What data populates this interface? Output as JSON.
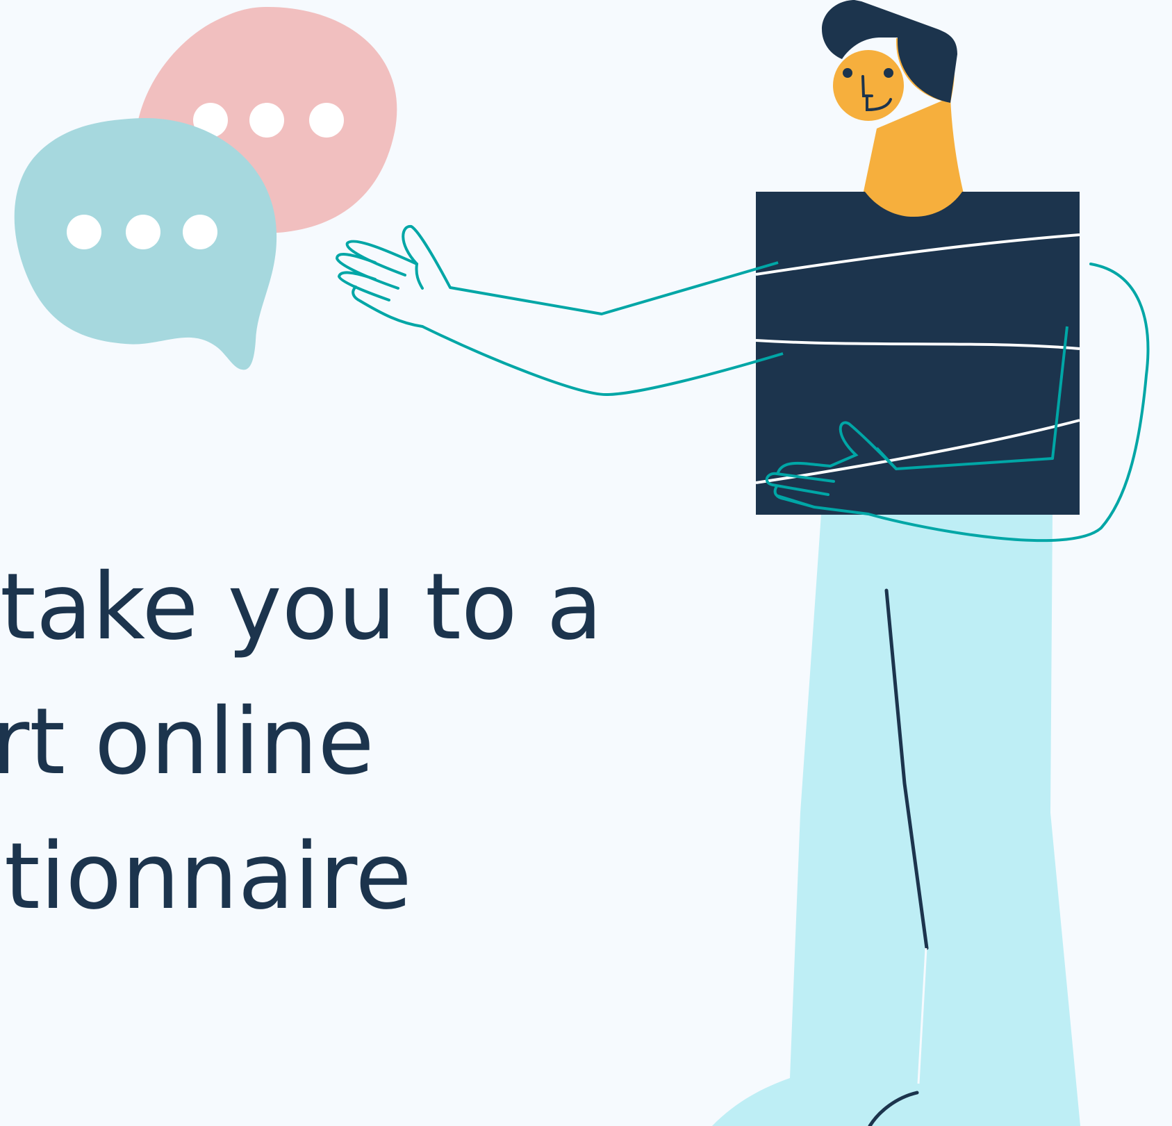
{
  "colors": {
    "background": "#F6FAFE",
    "text": "#1C344D",
    "navy": "#1C344D",
    "skin": "#F6AF3D",
    "pants": "#BEEEF5",
    "teal": "#00A6A6",
    "bubble_pink": "#F1BFBF",
    "bubble_blue": "#A6D8DE",
    "white": "#FFFFFF"
  },
  "message": {
    "line1": "take you to a",
    "line2": "rt online",
    "line3": "tionnaire"
  },
  "icons": {
    "bubble_pink": "speech-bubble-dots",
    "bubble_blue": "speech-bubble-dots",
    "character": "person-holding-shirt"
  }
}
